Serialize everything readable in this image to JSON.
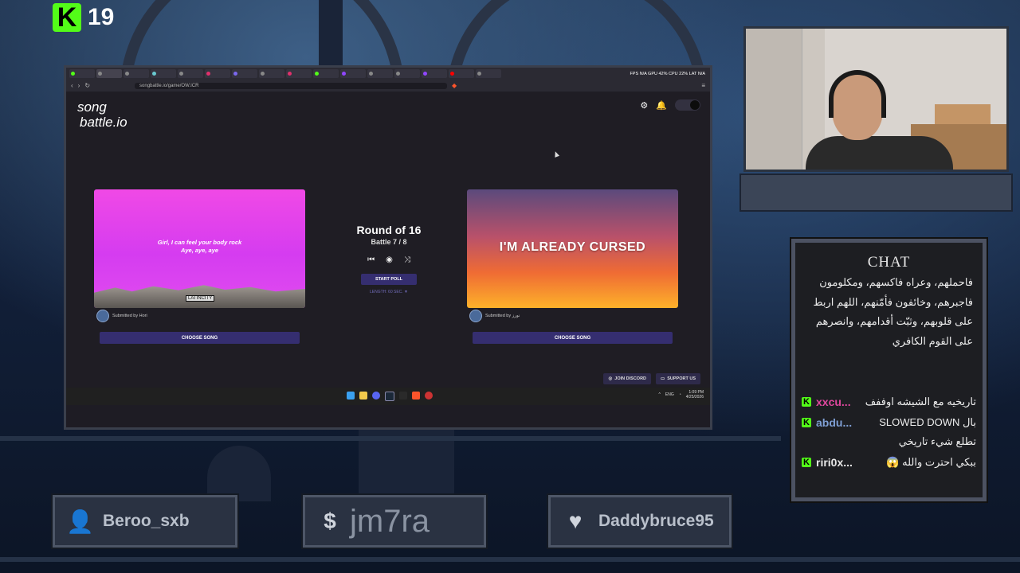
{
  "overlay": {
    "kick_count": "19",
    "chat_title": "CHAT",
    "bars": [
      {
        "icon": "user-icon",
        "glyph": "👤",
        "text": "Beroo_sxb"
      },
      {
        "icon": "dollar-icon",
        "glyph": "$",
        "text": "jm7ra"
      },
      {
        "icon": "heart-icon",
        "glyph": "♥",
        "text": "Daddybruce95"
      }
    ]
  },
  "browser": {
    "sys_stats": "FPS N/A GPU 42% CPU 22% LAT N/A",
    "url": "songbattle.io/game/OW.ICR",
    "cursor_visible": true
  },
  "page": {
    "logo_line1": "song",
    "logo_line2": "battle.io",
    "round_title": "Round of 16",
    "battle_progress": "Battle 7 / 8",
    "start_poll": "START POLL",
    "length": "LENGTH: 60 SEC. ▼",
    "left": {
      "lyric_line1": "Girl, I can feel your body rock",
      "lyric_line2": "Aye, aye, aye",
      "badge": "LATINCITY",
      "submitted_by": "Submitted by Hori",
      "choose": "CHOOSE SONG"
    },
    "right": {
      "title": "I'M ALREADY CURSED",
      "submitted_by": "Submitted by نورز",
      "choose": "CHOOSE SONG"
    },
    "join_discord": "JOIN DISCORD",
    "support_us": "SUPPORT US",
    "taskbar_lang": "ENG",
    "clock_time": "1:09 PM",
    "clock_date": "4/25/2026"
  },
  "chat": {
    "continuation": "فاحملهم، وعراه فاكسهم، ومكلومون فاجبرهم، وخائفون فأمّنهم، اللهم اربط على قلوبهم، وثبّت أقدامهم، وانصرهم على القوم الكافري",
    "messages": [
      {
        "user": "xxcu...",
        "color": "#e0479e",
        "text": "تاريخيه مع الشيشه اوففف"
      },
      {
        "user": "abdu...",
        "color": "#7f9fd4",
        "text": "بال SLOWED DOWN تطلع شيء تاريخي"
      },
      {
        "user": "riri0x...",
        "color": "#e8e8e8",
        "text": "ببكي احترت والله 😱"
      }
    ]
  }
}
